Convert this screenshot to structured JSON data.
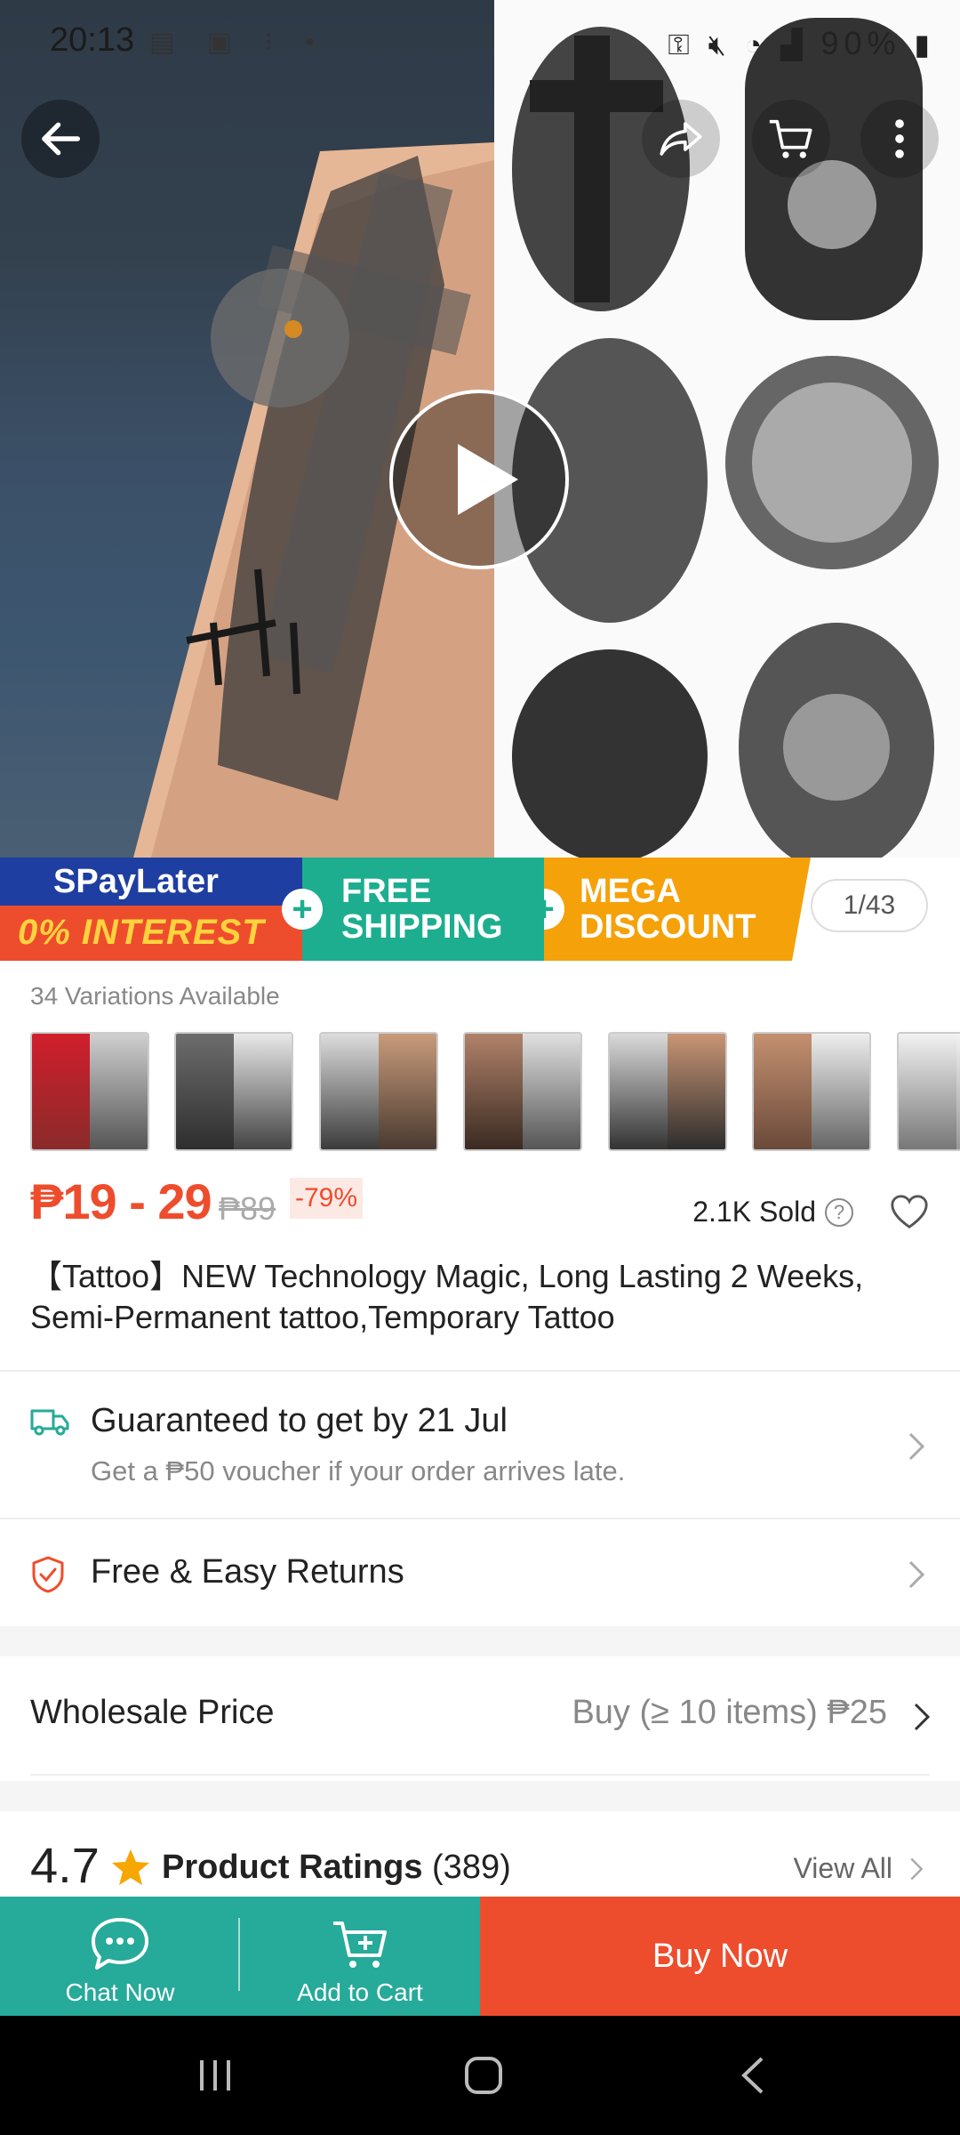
{
  "status_bar": {
    "time": "20:13",
    "battery": "90%"
  },
  "media": {
    "counter": "1/43"
  },
  "promo": {
    "spaylater_title": "SPayLater",
    "spaylater_sub": "0% INTEREST",
    "free_shipping_1": "FREE",
    "free_shipping_2": "SHIPPING",
    "mega_discount_1": "MEGA",
    "mega_discount_2": "DISCOUNT"
  },
  "variations": {
    "label": "34 Variations Available"
  },
  "price": {
    "range": "₱19 - 29",
    "original": "₱89",
    "discount": "-79%",
    "sold": "2.1K Sold"
  },
  "product": {
    "title": "【Tattoo】NEW Technology Magic, Long Lasting 2 Weeks, Semi-Permanent tattoo,Temporary Tattoo"
  },
  "shipping": {
    "title": "Guaranteed to get by 21 Jul",
    "subtitle": "Get a ₱50 voucher if your order arrives late."
  },
  "returns": {
    "title": "Free & Easy Returns"
  },
  "wholesale": {
    "label": "Wholesale Price",
    "value": "Buy (≥ 10 items) ₱25"
  },
  "ratings": {
    "score": "4.7",
    "label": "Product Ratings",
    "count": "(389)",
    "view_all": "View All"
  },
  "actions": {
    "chat": "Chat Now",
    "cart": "Add to Cart",
    "buy": "Buy Now"
  },
  "colors": {
    "brand_orange": "#ee4d2d",
    "teal": "#26aa99"
  }
}
